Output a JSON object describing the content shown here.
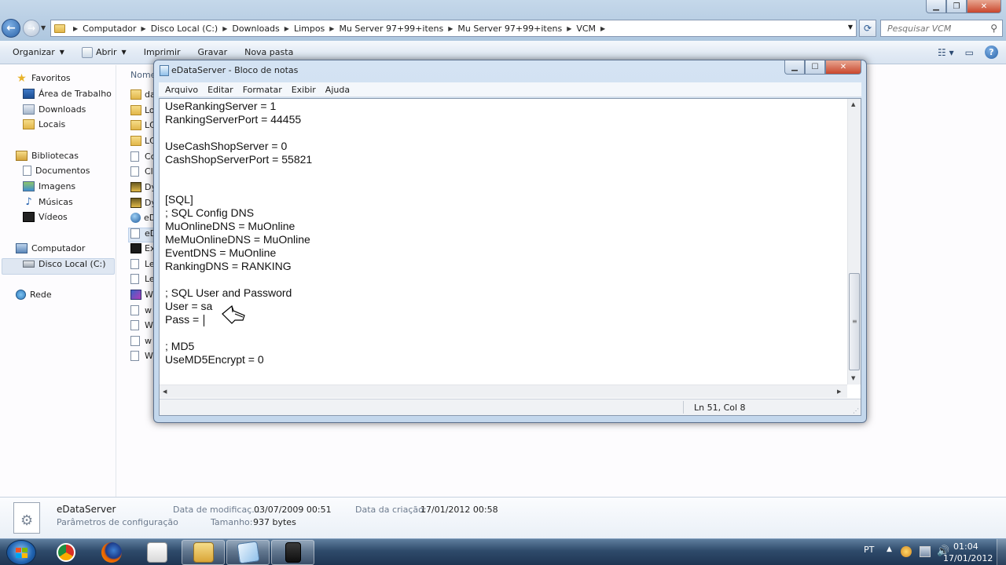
{
  "explorer": {
    "breadcrumbs": [
      "Computador",
      "Disco Local (C:)",
      "Downloads",
      "Limpos",
      "Mu Server 97+99+itens",
      "Mu Server 97+99+itens",
      "VCM"
    ],
    "search_placeholder": "Pesquisar VCM",
    "toolbar": {
      "organize": "Organizar",
      "open": "Abrir",
      "print": "Imprimir",
      "save": "Gravar",
      "new_folder": "Nova pasta"
    },
    "column_name": "Nome",
    "nav": {
      "favorites": "Favoritos",
      "desktop": "Área de Trabalho",
      "downloads": "Downloads",
      "places": "Locais",
      "libraries": "Bibliotecas",
      "documents": "Documentos",
      "images": "Imagens",
      "music": "Músicas",
      "videos": "Vídeos",
      "computer": "Computador",
      "local_disk": "Disco Local (C:)",
      "network": "Rede"
    },
    "files": [
      "da",
      "Lo",
      "LC",
      "LC",
      "Cc",
      "Cl",
      "Dy",
      "Dy",
      "eD",
      "eD",
      "Ex",
      "Le",
      "Le",
      "W",
      "w",
      "W",
      "w",
      "W"
    ],
    "details": {
      "name": "eDataServer",
      "type": "Parâmetros de configuração",
      "modified_label": "Data de modificaç...",
      "modified_value": "03/07/2009 00:51",
      "size_label": "Tamanho:",
      "size_value": "937 bytes",
      "created_label": "Data da criação:",
      "created_value": "17/01/2012 00:58"
    }
  },
  "notepad": {
    "title": "eDataServer - Bloco de notas",
    "menu": [
      "Arquivo",
      "Editar",
      "Formatar",
      "Exibir",
      "Ajuda"
    ],
    "lines": [
      "UseRankingServer = 1",
      "RankingServerPort = 44455",
      "",
      "UseCashShopServer = 0",
      "CashShopServerPort = 55821",
      "",
      "",
      "[SQL]",
      "; SQL Config DNS",
      "MuOnlineDNS = MuOnline",
      "MeMuOnlineDNS = MuOnline",
      "EventDNS = MuOnline",
      "RankingDNS = RANKING",
      "",
      "; SQL User and Password",
      "User = sa",
      "Pass = ",
      "",
      "; MD5",
      "UseMD5Encrypt = 0"
    ],
    "status_position": "Ln 51, Col 8"
  },
  "taskbar": {
    "language": "PT",
    "time": "01:04",
    "date": "17/01/2012"
  }
}
